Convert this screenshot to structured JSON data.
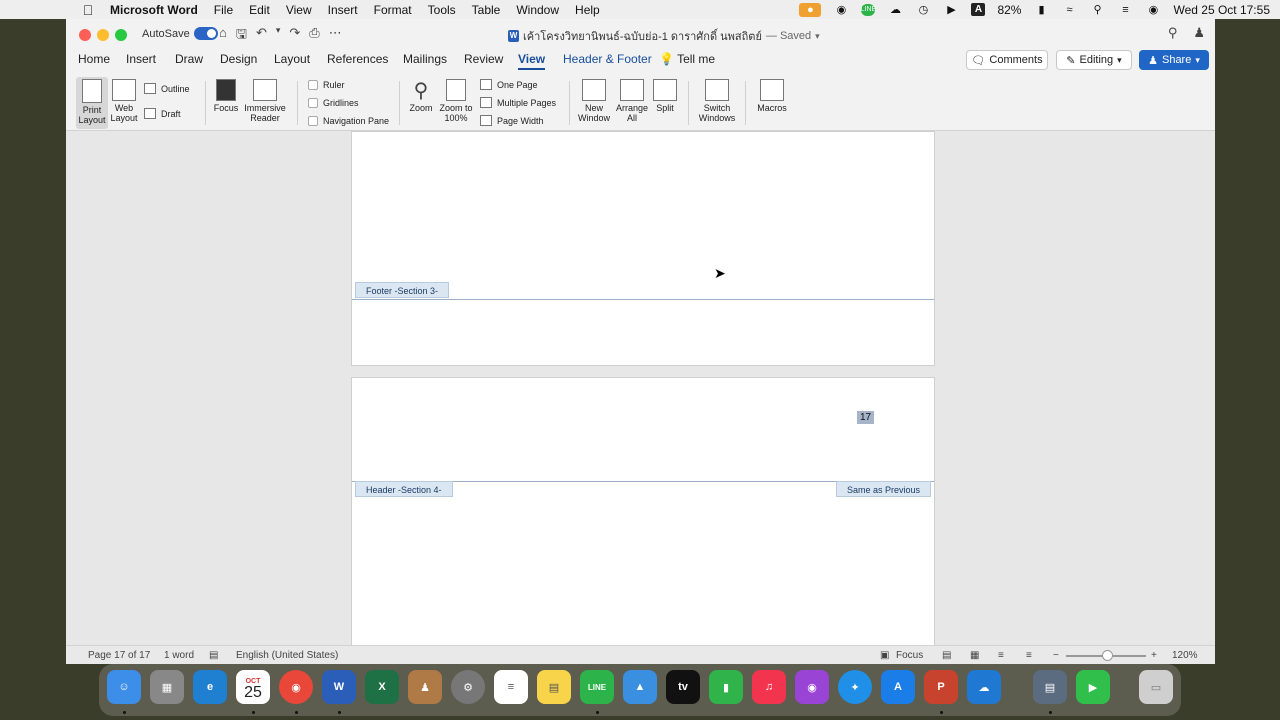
{
  "menubar": {
    "app_name": "Microsoft Word",
    "items": [
      "File",
      "Edit",
      "View",
      "Insert",
      "Format",
      "Tools",
      "Table",
      "Window",
      "Help"
    ],
    "battery": "82%",
    "clock": "Wed 25 Oct  17:55"
  },
  "titlebar": {
    "autosave_label": "AutoSave",
    "doc_title": "เค้าโครงวิทยานิพนธ์-ฉบับย่อ-1 ดาราศักดิ์ นพสถิตย์",
    "saved_status": "— Saved"
  },
  "tabs": {
    "items": [
      "Home",
      "Insert",
      "Draw",
      "Design",
      "Layout",
      "References",
      "Mailings",
      "Review",
      "View",
      "Header & Footer"
    ],
    "active": "View",
    "tell_me": "Tell me",
    "comments": "Comments",
    "editing": "Editing",
    "share": "Share"
  },
  "ribbon": {
    "print_layout": "Print Layout",
    "web_layout": "Web Layout",
    "outline": "Outline",
    "draft": "Draft",
    "focus": "Focus",
    "immersive_reader": "Immersive Reader",
    "ruler": "Ruler",
    "gridlines": "Gridlines",
    "navigation_pane": "Navigation Pane",
    "zoom": "Zoom",
    "zoom_100": "Zoom to 100%",
    "one_page": "One Page",
    "multiple_pages": "Multiple Pages",
    "page_width": "Page Width",
    "new_window": "New Window",
    "arrange_all": "Arrange All",
    "split": "Split",
    "switch_windows": "Switch Windows",
    "macros": "Macros"
  },
  "document": {
    "footer_tag": "Footer -Section 3-",
    "header_tag": "Header -Section 4-",
    "same_as_previous": "Same as Previous",
    "page_number": "17"
  },
  "status": {
    "page": "Page 17 of 17",
    "words": "1 word",
    "language": "English (United States)",
    "focus": "Focus",
    "zoom": "120%"
  },
  "dock": {
    "calendar_month": "OCT",
    "calendar_day": "25",
    "tv_label": "tv"
  }
}
